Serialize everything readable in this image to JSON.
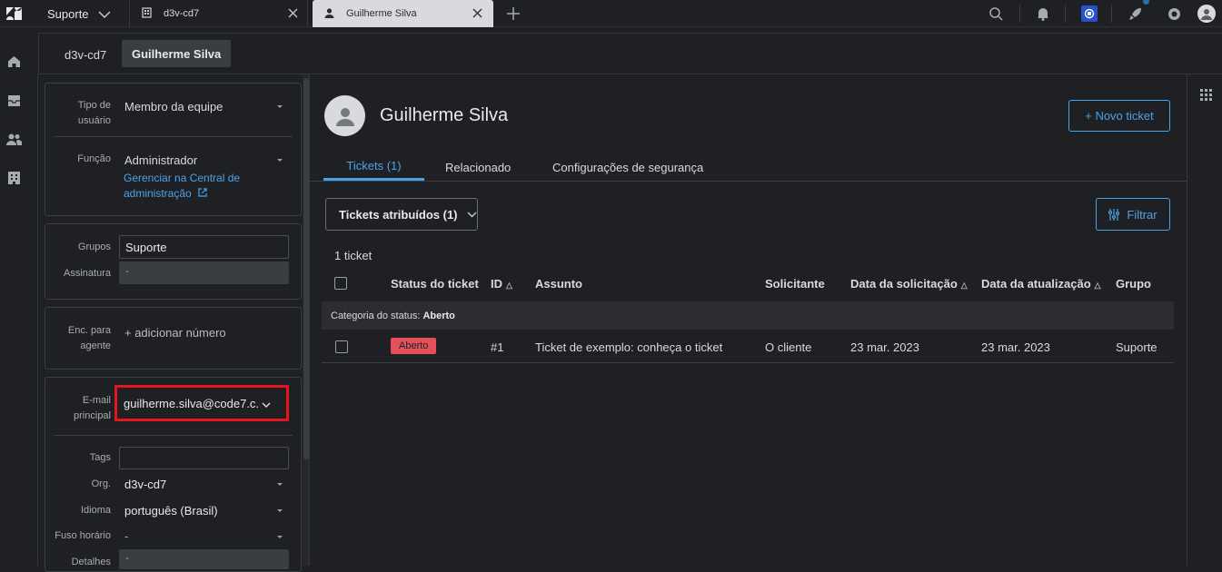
{
  "topbar": {
    "workspace": "Suporte",
    "tabs": [
      {
        "label": "d3v-cd7"
      },
      {
        "label": "Guilherme Silva"
      }
    ]
  },
  "subtabs": [
    "d3v-cd7",
    "Guilherme Silva"
  ],
  "user_form": {
    "tipo_label": "Tipo de usuário",
    "tipo_value": "Membro da equipe",
    "funcao_label": "Função",
    "funcao_value": "Administrador",
    "funcao_link": "Gerenciar na Central de administração",
    "grupos_label": "Grupos",
    "grupos_value": "Suporte",
    "assinatura_label": "Assinatura",
    "assinatura_value": "-",
    "enc_label": "Enc. para agente",
    "enc_value": "+ adicionar número",
    "email_label": "E-mail principal",
    "email_value": "guilherme.silva@code7.c...",
    "tags_label": "Tags",
    "org_label": "Org.",
    "org_value": "d3v-cd7",
    "idioma_label": "Idioma",
    "idioma_value": "português (Brasil)",
    "fuso_label": "Fuso horário",
    "fuso_value": "-",
    "detalhes_label": "Detalhes",
    "detalhes_value": "-"
  },
  "profile": {
    "name": "Guilherme Silva",
    "new_ticket_button": "+ Novo ticket",
    "tabs": [
      "Tickets (1)",
      "Relacionado",
      "Configurações de segurança"
    ]
  },
  "tickets": {
    "filter_select": "Tickets atribuídos (1)",
    "filter_button": "Filtrar",
    "count": "1 ticket",
    "columns": [
      "Status do ticket",
      "ID",
      "Assunto",
      "Solicitante",
      "Data da solicitação",
      "Data da atualização",
      "Grupo"
    ],
    "group_header_prefix": "Categoria do status:",
    "group_header_value": "Aberto",
    "rows": [
      {
        "status": "Aberto",
        "id": "#1",
        "subject": "Ticket de exemplo: conheça o ticket",
        "requester": "O cliente",
        "requested": "23 mar. 2023",
        "updated": "23 mar. 2023",
        "group": "Suporte"
      }
    ]
  },
  "colors": {
    "accent": "#4aa3e8",
    "status_open": "#e34f5b",
    "highlight_box": "#e3151f"
  }
}
